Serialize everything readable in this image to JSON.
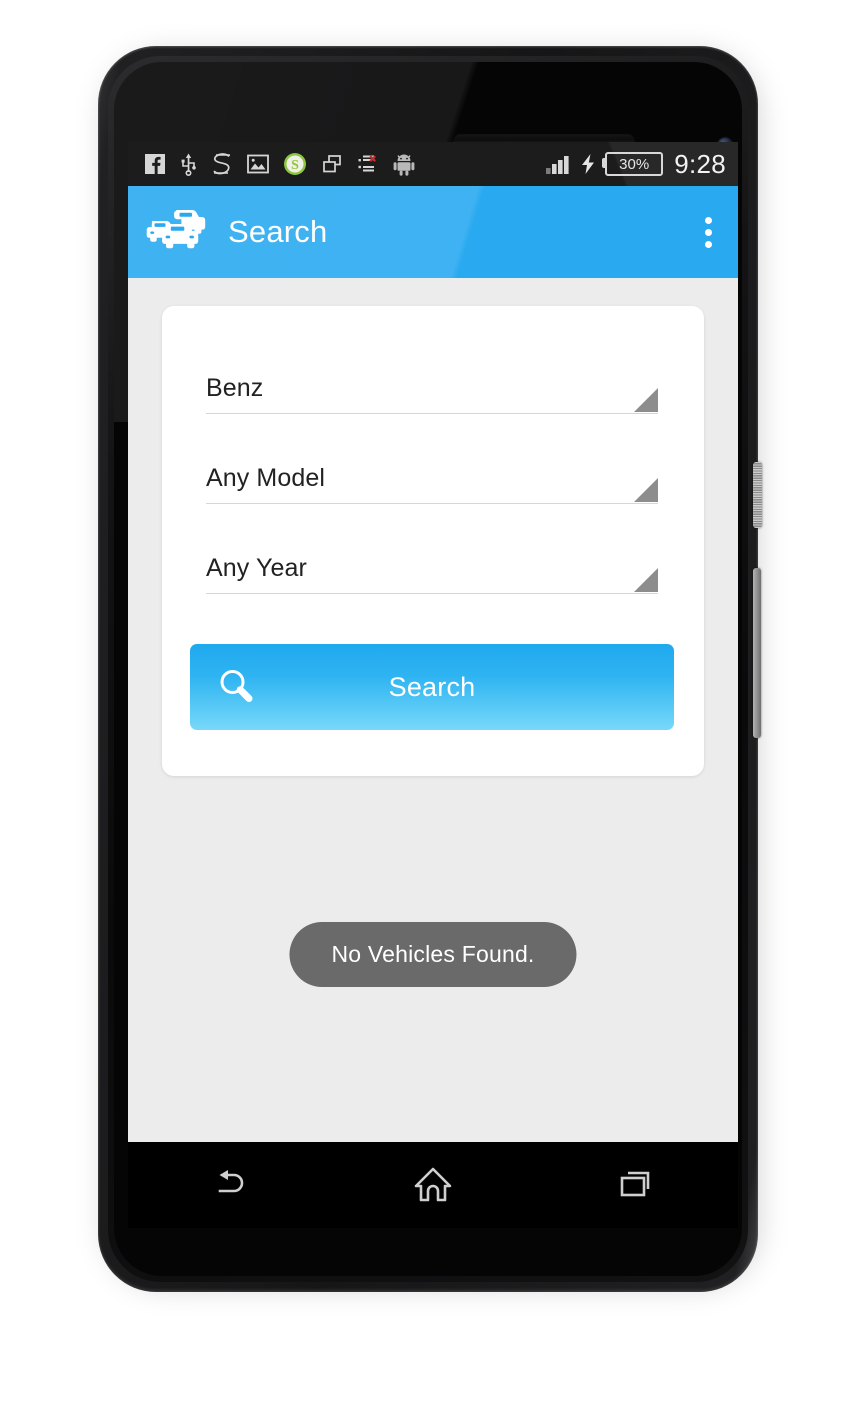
{
  "device": {
    "name": "android-phone-mockup",
    "earpiece": "speaker-grille",
    "camera": "front-camera",
    "buttons": [
      "power-button",
      "volume-rocker"
    ]
  },
  "status_bar": {
    "icons": [
      "facebook-icon",
      "usb-icon",
      "s-letter-icon",
      "gallery-image-icon",
      "green-s-circle-icon",
      "copy-windows-icon",
      "list-error-icon",
      "android-robot-icon"
    ],
    "signal": "signal-bars-icon",
    "charging": "charging-bolt-icon",
    "battery_text": "30%",
    "time": "9:28"
  },
  "app_bar": {
    "icon": "two-cars-icon",
    "title": "Search",
    "overflow": "overflow-menu-icon",
    "background_color": "#28a9f0"
  },
  "form": {
    "spinners": [
      {
        "name": "make",
        "value": "Benz"
      },
      {
        "name": "model",
        "value": "Any Model"
      },
      {
        "name": "year",
        "value": "Any Year"
      }
    ],
    "search_button": {
      "label": "Search",
      "icon": "magnifier-icon",
      "gradient_top": "#1fa9ee",
      "gradient_bottom": "#79d8f9"
    }
  },
  "toast": {
    "message": "No Vehicles Found.",
    "background_color": "#6a6a6a"
  },
  "nav_bar": {
    "buttons": [
      "back-icon",
      "home-icon",
      "recent-apps-icon"
    ]
  }
}
